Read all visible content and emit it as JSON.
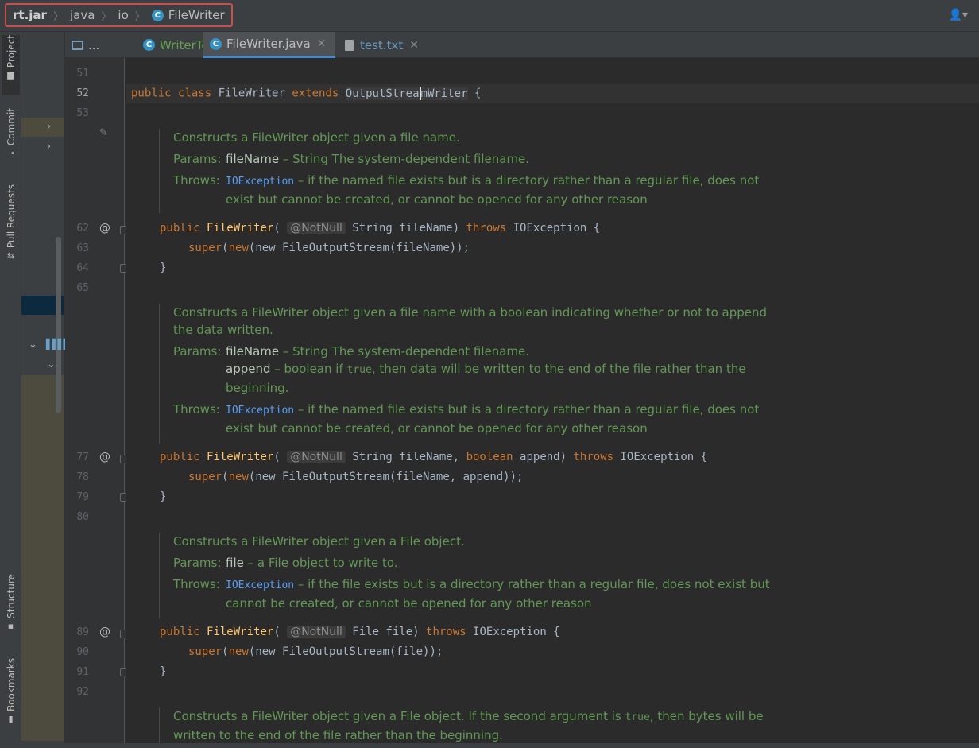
{
  "breadcrumb": {
    "root": "rt.jar",
    "pkg1": "java",
    "pkg2": "io",
    "cls": "FileWriter"
  },
  "class_icon_letter": "C",
  "user_icon": "👤▾",
  "side_tabs": {
    "project": "Project",
    "commit": "Commit",
    "pull_requests": "Pull Requests",
    "structure": "Structure",
    "bookmarks": "Bookmarks"
  },
  "editor_tabs": {
    "dots": "...",
    "tab1": "WriterTest.java",
    "tab2": "FileWriter.java",
    "tab3": "test.txt",
    "close": "✕"
  },
  "line_numbers": {
    "l51": "51",
    "l52": "52",
    "l53": "53",
    "l62": "62",
    "l63": "63",
    "l64": "64",
    "l65": "65",
    "l77": "77",
    "l78": "78",
    "l79": "79",
    "l80": "80",
    "l89": "89",
    "l90": "90",
    "l91": "91",
    "l92": "92"
  },
  "gutter": {
    "at": "@",
    "pencil": "✎"
  },
  "code": {
    "public": "public",
    "class": "class",
    "extends": "extends",
    "super": "super",
    "new": "new",
    "throws": "throws",
    "boolean": "boolean",
    "class_name": "FileWriter",
    "parent_a": "OutputStrea",
    "parent_b": "mWriter",
    "brace_open": "{",
    "brace_close": "}",
    "notnull": "@NotNull",
    "ctor1_params": "String fileName)",
    "ctor1_body": "(new FileOutputStream(fileName));",
    "ctor2_p1": "String fileName,",
    "ctor2_p2": "append)",
    "ctor2_body": "(new FileOutputStream(fileName, append));",
    "ctor3_params": "File file)",
    "ctor3_body": "(new FileOutputStream(file));",
    "ioexception": "IOException {",
    "paren": "("
  },
  "docs": {
    "params_label": "Params:",
    "throws_label": "Throws:",
    "ioexception": "IOException",
    "d1_summary": "Constructs a FileWriter object given a file name.",
    "d1_param": "fileName",
    "d1_param_desc": " – String The system-dependent filename.",
    "d1_throws": " – if the named file exists but is a directory rather than a regular file, does not",
    "d1_throws2": "exist but cannot be created, or cannot be opened for any other reason",
    "d2_summary": "Constructs a FileWriter object given a file name with a boolean indicating whether or not to append",
    "d2_summary2": "the data written.",
    "d2_param1": "fileName",
    "d2_param1_desc": " – String The system-dependent filename.",
    "d2_param2": "append",
    "d2_param2_desc_a": " – boolean if ",
    "d2_true": "true",
    "d2_param2_desc_b": ", then data will be written to the end of the file rather than the",
    "d2_param2_desc2": "beginning.",
    "d2_throws": " – if the named file exists but is a directory rather than a regular file, does not",
    "d2_throws2": "exist but cannot be created, or cannot be opened for any other reason",
    "d3_summary": "Constructs a FileWriter object given a File object.",
    "d3_param": "file",
    "d3_param_desc": " – a File object to write to.",
    "d3_throws": " – if the file exists but is a directory rather than a regular file, does not exist but",
    "d3_throws2": "cannot be created, or cannot be opened for any other reason",
    "d4_summary_a": "Constructs a FileWriter object given a File object. If the second argument is ",
    "d4_true": "true",
    "d4_summary_b": ", then bytes will be",
    "d4_summary2": "written to the end of the file rather than the beginning."
  },
  "colors": {
    "background": "#2b2b2b",
    "keyword": "#cc7832",
    "method": "#ffc66d",
    "doc": "#629755",
    "accent": "#4a88c7",
    "highlight_box": "#c94f4f"
  }
}
